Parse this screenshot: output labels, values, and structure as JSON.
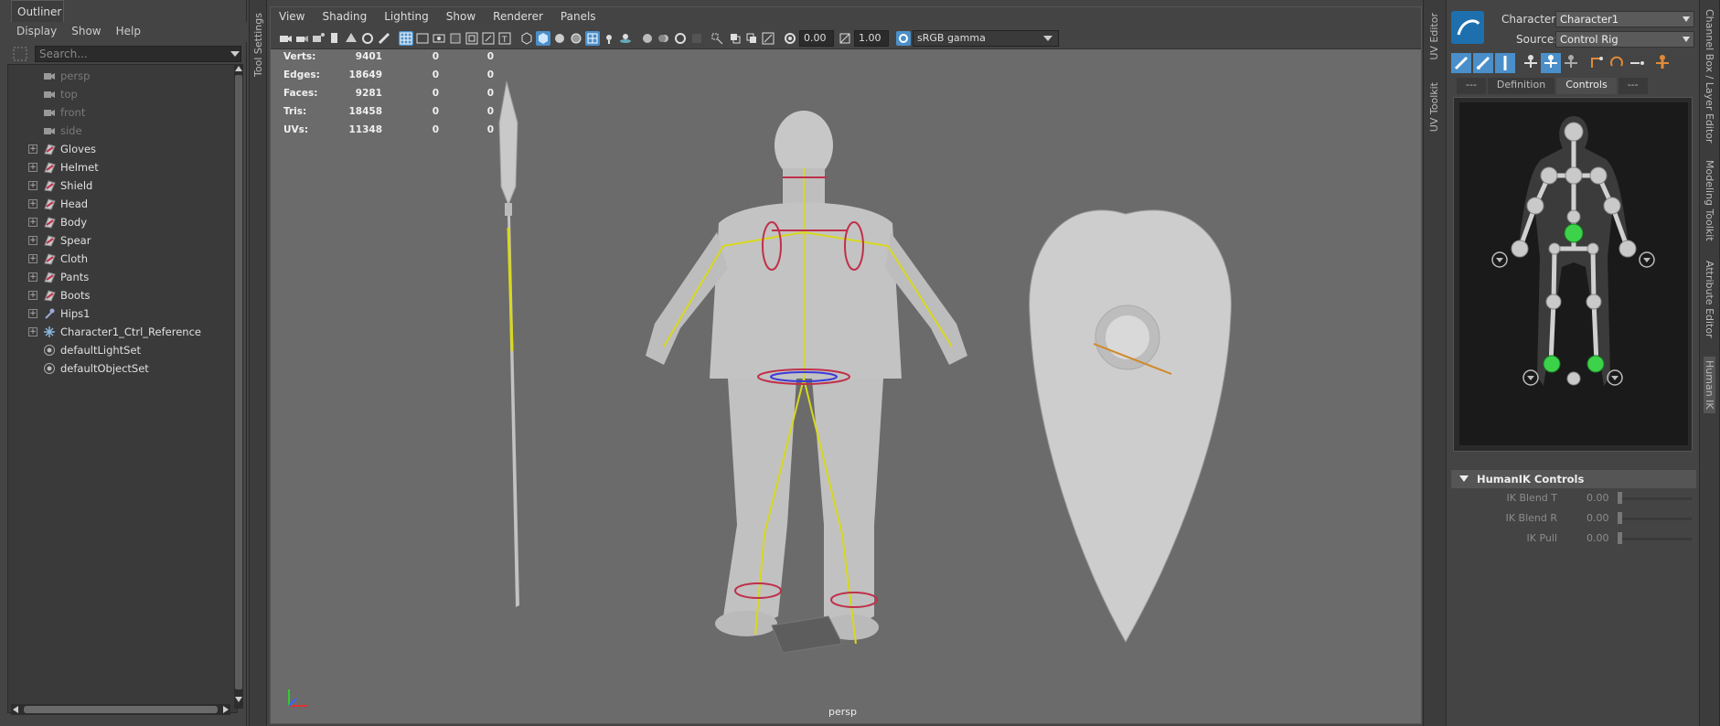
{
  "outliner": {
    "title": "Outliner",
    "menu": [
      "Display",
      "Show",
      "Help"
    ],
    "search_placeholder": "Search...",
    "items": [
      {
        "label": "persp",
        "icon": "camera-icon",
        "dim": true,
        "expandable": false
      },
      {
        "label": "top",
        "icon": "camera-icon",
        "dim": true,
        "expandable": false
      },
      {
        "label": "front",
        "icon": "camera-icon",
        "dim": true,
        "expandable": false
      },
      {
        "label": "side",
        "icon": "camera-icon",
        "dim": true,
        "expandable": false
      },
      {
        "label": "Gloves",
        "icon": "mesh-icon",
        "dim": false,
        "expandable": true
      },
      {
        "label": "Helmet",
        "icon": "mesh-icon",
        "dim": false,
        "expandable": true
      },
      {
        "label": "Shield",
        "icon": "mesh-icon",
        "dim": false,
        "expandable": true
      },
      {
        "label": "Head",
        "icon": "mesh-icon",
        "dim": false,
        "expandable": true
      },
      {
        "label": "Body",
        "icon": "mesh-icon",
        "dim": false,
        "expandable": true
      },
      {
        "label": "Spear",
        "icon": "mesh-icon",
        "dim": false,
        "expandable": true
      },
      {
        "label": "Cloth",
        "icon": "mesh-icon",
        "dim": false,
        "expandable": true
      },
      {
        "label": "Pants",
        "icon": "mesh-icon",
        "dim": false,
        "expandable": true
      },
      {
        "label": "Boots",
        "icon": "mesh-icon",
        "dim": false,
        "expandable": true
      },
      {
        "label": "Hips1",
        "icon": "joint-icon",
        "dim": false,
        "expandable": true
      },
      {
        "label": "Character1_Ctrl_Reference",
        "icon": "ik-reference-icon",
        "dim": false,
        "expandable": true
      },
      {
        "label": "defaultLightSet",
        "icon": "set-icon",
        "dim": false,
        "expandable": false
      },
      {
        "label": "defaultObjectSet",
        "icon": "set-icon",
        "dim": false,
        "expandable": false
      }
    ]
  },
  "tool_settings_label": "Tool Settings",
  "viewport": {
    "menu": [
      "View",
      "Shading",
      "Lighting",
      "Show",
      "Renderer",
      "Panels"
    ],
    "exposure": "0.00",
    "gamma": "1.00",
    "color_space": "sRGB gamma",
    "camera_label": "persp",
    "hud": [
      {
        "label": "Verts:",
        "a": "9401",
        "b": "0",
        "c": "0"
      },
      {
        "label": "Edges:",
        "a": "18649",
        "b": "0",
        "c": "0"
      },
      {
        "label": "Faces:",
        "a": "9281",
        "b": "0",
        "c": "0"
      },
      {
        "label": "Tris:",
        "a": "18458",
        "b": "0",
        "c": "0"
      },
      {
        "label": "UVs:",
        "a": "11348",
        "b": "0",
        "c": "0"
      }
    ]
  },
  "left_side_tabs": [
    "UV Editor",
    "UV Toolkit"
  ],
  "right_side_tabs": [
    "Channel Box / Layer Editor",
    "Modeling Toolkit",
    "Attribute Editor",
    "Human IK"
  ],
  "humanik": {
    "character_label": "Character:",
    "character_value": "Character1",
    "source_label": "Source:",
    "source_value": "Control Rig",
    "tabs": [
      "---",
      "Definition",
      "Controls",
      "---"
    ],
    "active_tab": "Controls",
    "section_title": "HumanIK Controls",
    "sliders": [
      {
        "label": "IK Blend T",
        "value": "0.00"
      },
      {
        "label": "IK Blend R",
        "value": "0.00"
      },
      {
        "label": "IK Pull",
        "value": "0.00"
      }
    ]
  },
  "colors": {
    "ui_bg": "#444444",
    "viewport_bg": "#6b6b6b",
    "accent_blue": "#4a8fc9",
    "skeleton_yellow": "#d8d81e",
    "ik_green": "#3cd24a"
  }
}
